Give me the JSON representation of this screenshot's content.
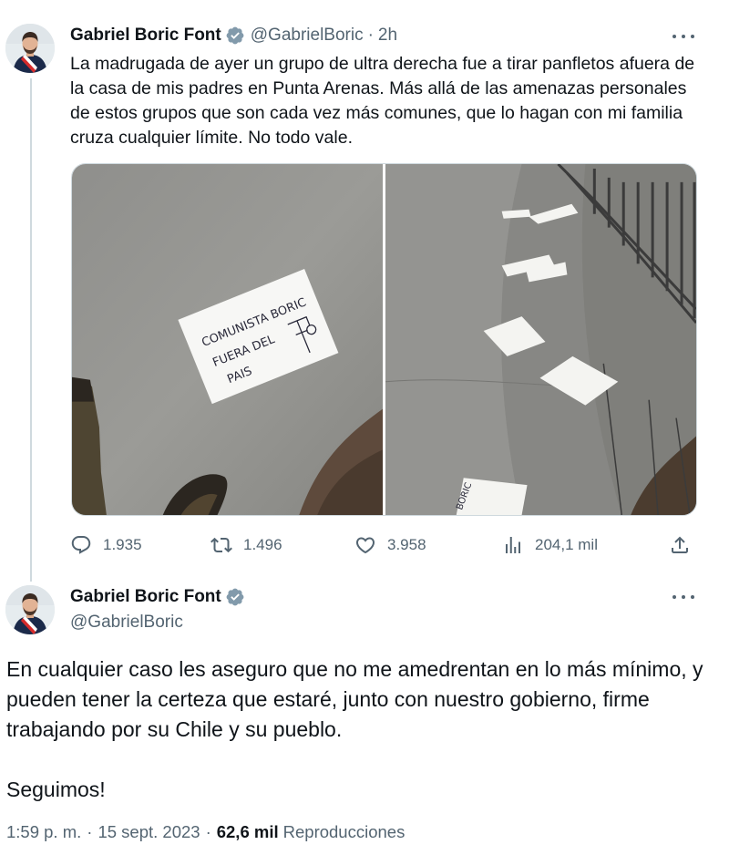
{
  "tweet1": {
    "author_name": "Gabriel Boric Font",
    "handle": "@GabrielBoric",
    "separator": "·",
    "time": "2h",
    "text": "La madrugada de ayer un grupo de ultra derecha fue a tirar panfletos afuera de la casa de mis padres en Punta Arenas. Más allá de las amenazas personales de estos grupos que son cada vez más comunes, que lo hagan con mi familia cruza cualquier límite. No todo vale.",
    "photo1_note_lines": [
      "COMUNISTA BORIC",
      "FUERA DEL",
      "PAIS"
    ],
    "photo2_note_text": "BORIC",
    "stats": {
      "replies": "1.935",
      "reposts": "1.496",
      "likes": "3.958",
      "views": "204,1 mil"
    },
    "icons": [
      "reply-icon",
      "repost-icon",
      "like-icon",
      "views-icon",
      "share-icon",
      "verified-badge-icon",
      "more-icon"
    ]
  },
  "tweet2": {
    "author_name": "Gabriel Boric Font",
    "handle": "@GabrielBoric",
    "paragraph1": "En cualquier caso les aseguro que no me amedrentan en lo más mínimo, y pueden tener la certeza que estaré, junto con nuestro gobierno, firme trabajando por su Chile y su pueblo.",
    "paragraph2": "Seguimos!",
    "time": "1:59 p. m.",
    "date": "15 sept. 2023",
    "separator": "·",
    "views_count": "62,6 mil",
    "views_label": "Reproducciones"
  },
  "colors": {
    "text": "#0f1419",
    "secondary": "#536471",
    "verified": "#829aab",
    "thread_line": "#cfd9de"
  }
}
